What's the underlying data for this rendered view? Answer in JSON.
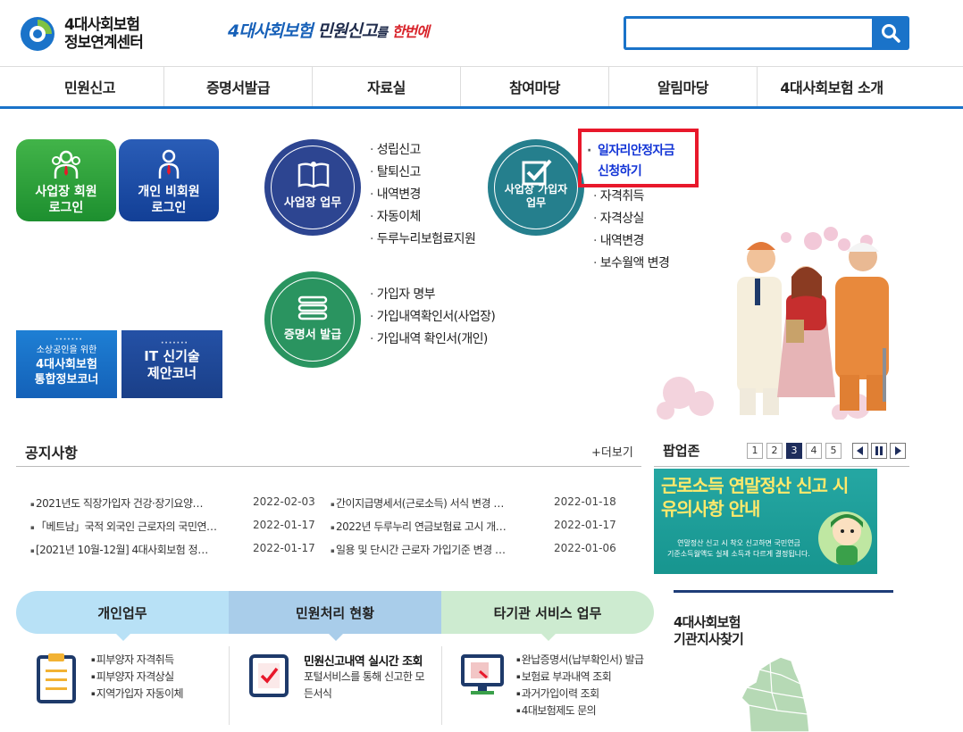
{
  "header": {
    "logo_line1": "4대사회보험",
    "logo_line2": "정보연계센터",
    "slogan_part1": "4대사회보험",
    "slogan_part2": "민원신고",
    "slogan_part3": "를",
    "slogan_part4": "한번에",
    "search_value": ""
  },
  "nav": [
    "민원신고",
    "증명서발급",
    "자료실",
    "참여마당",
    "알림마당",
    "4대사회보험 소개"
  ],
  "login": {
    "biz_line1": "사업장 회원",
    "biz_line2": "로그인",
    "indiv_line1": "개인 비회원",
    "indiv_line2": "로그인"
  },
  "banners": {
    "corner_line1": "소상공인을 위한",
    "corner_line2": "4대사회보험",
    "corner_line3": "통합정보코너",
    "it_line1": "IT 신기술",
    "it_line2": "제안코너"
  },
  "services": {
    "biz": {
      "label": "사업장 업무",
      "items": [
        "성립신고",
        "탈퇴신고",
        "내역변경",
        "자동이체",
        "두루누리보험료지원"
      ]
    },
    "subscriber": {
      "label_line1": "사업장 가입자",
      "label_line2": "업무",
      "highlight_line1": "일자리안정자금",
      "highlight_line2": "신청하기",
      "items": [
        "자격취득",
        "자격상실",
        "내역변경",
        "보수월액 변경"
      ]
    },
    "cert": {
      "label": "증명서 발급",
      "items": [
        "가입자 명부",
        "가입내역확인서(사업장)",
        "가입내역 확인서(개인)"
      ]
    }
  },
  "notice": {
    "title": "공지사항",
    "more": "+더보기",
    "items": [
      {
        "title": "2021년도 직장가입자 건강·장기요양…",
        "date": "2022-02-03"
      },
      {
        "title": "간이지급명세서(근로소득) 서식 변경 …",
        "date": "2022-01-18"
      },
      {
        "title": "「베트남」국적 외국인 근로자의 국민연…",
        "date": "2022-01-17"
      },
      {
        "title": "2022년 두루누리 연금보험료 고시 개…",
        "date": "2022-01-17"
      },
      {
        "title": "[2021년 10월-12월] 4대사회보험 정…",
        "date": "2022-01-17"
      },
      {
        "title": "일용 및 단시간 근로자 가입기준 변경 …",
        "date": "2022-01-06"
      }
    ]
  },
  "popup": {
    "title": "팝업존",
    "pages": [
      "1",
      "2",
      "3",
      "4",
      "5"
    ],
    "active_page": "3",
    "banner_line1": "근로소득 연말정산 신고 시",
    "banner_line2": "유의사항 안내",
    "banner_desc1": "연말정산 신고 시 착오 신고하면 국민연금",
    "banner_desc2": "기준소득월액도 실제 소득과 다르게 결정됩니다."
  },
  "tabs": {
    "personal": {
      "title": "개인업무",
      "items": [
        "피부양자 자격취득",
        "피부양자 자격상실",
        "지역가입자 자동이체"
      ]
    },
    "status": {
      "title": "민원처리 현황",
      "item_title": "민원신고내역 실시간 조회",
      "item_desc": "포털서비스를 통해 신고한 모든서식"
    },
    "other": {
      "title": "타기관 서비스 업무",
      "items": [
        "완납증명서(납부확인서) 발급",
        "보험료 부과내역 조회",
        "과거가입이력 조회",
        "4대보험제도 문의"
      ]
    }
  },
  "branch": {
    "title_line1": "4대사회보험",
    "title_line2": "기관지사찾기"
  },
  "colors": {
    "primary_blue": "#1a73c9",
    "highlight_red": "#e8182b",
    "highlight_text": "#1234d6"
  }
}
